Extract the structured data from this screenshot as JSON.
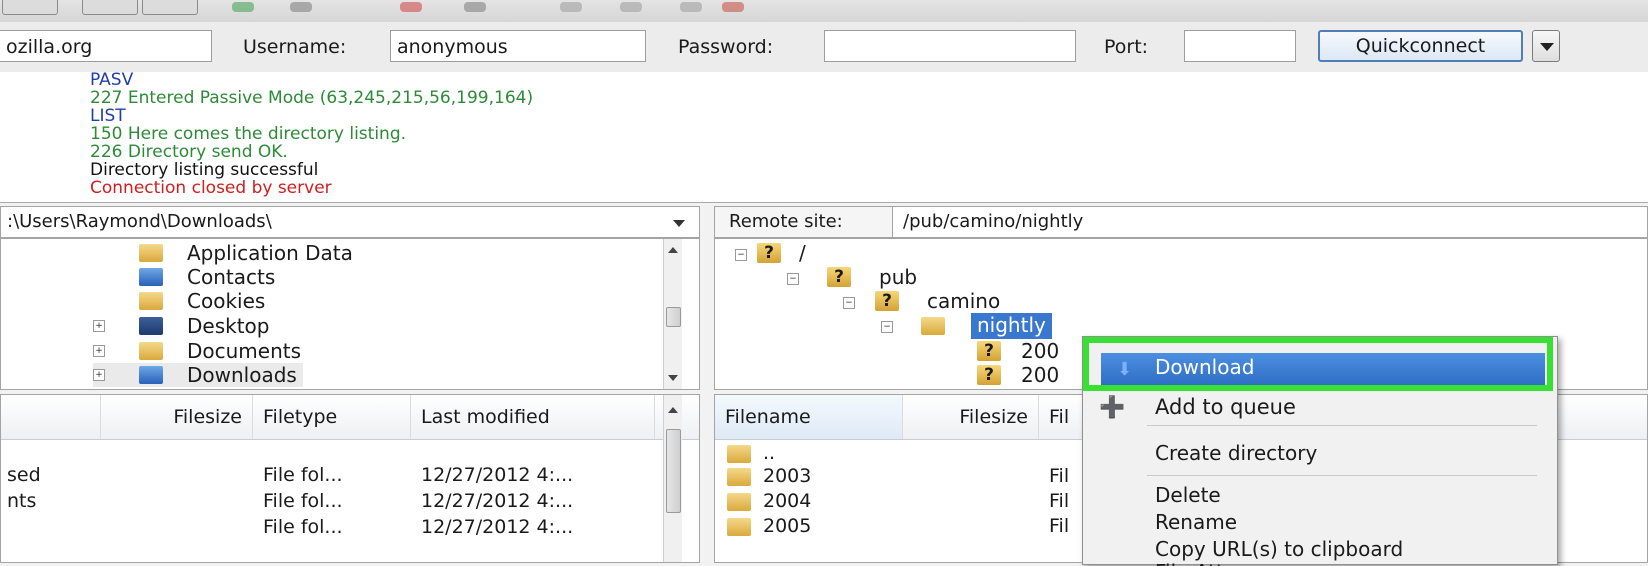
{
  "quickconnect": {
    "host_value": "ozilla.org",
    "username_label": "Username:",
    "username_value": "anonymous",
    "password_label": "Password:",
    "password_value": "",
    "port_label": "Port:",
    "port_value": "",
    "button_label": "Quickconnect"
  },
  "log": [
    {
      "text": "PASV",
      "color": "blue"
    },
    {
      "text": "227 Entered Passive Mode (63,245,215,56,199,164)",
      "color": "green"
    },
    {
      "text": "LIST",
      "color": "blue"
    },
    {
      "text": "150 Here comes the directory listing.",
      "color": "green"
    },
    {
      "text": "226 Directory send OK.",
      "color": "green"
    },
    {
      "text": "Directory listing successful",
      "color": "black"
    },
    {
      "text": "Connection closed by server",
      "color": "red"
    }
  ],
  "local": {
    "path": ":\\Users\\Raymond\\Downloads\\",
    "tree": [
      {
        "label": "Application Data"
      },
      {
        "label": "Contacts"
      },
      {
        "label": "Cookies"
      },
      {
        "label": "Desktop"
      },
      {
        "label": "Documents"
      },
      {
        "label": "Downloads"
      }
    ],
    "columns": [
      "Filesize",
      "Filetype",
      "Last modified"
    ],
    "rows": [
      {
        "name": "sed",
        "type": "File fol...",
        "modified": "12/27/2012 4:..."
      },
      {
        "name": "nts",
        "type": "File fol...",
        "modified": "12/27/2012 4:..."
      },
      {
        "name": "",
        "type": "File fol...",
        "modified": "12/27/2012 4:..."
      }
    ]
  },
  "remote": {
    "label": "Remote site:",
    "path": "/pub/camino/nightly",
    "tree": [
      {
        "label": "/"
      },
      {
        "label": "pub"
      },
      {
        "label": "camino"
      },
      {
        "label": "nightly"
      },
      {
        "label": "200"
      },
      {
        "label": "200"
      }
    ],
    "columns": [
      "Filename",
      "Filesize",
      "Fil"
    ],
    "rows": [
      {
        "name": "..",
        "type": ""
      },
      {
        "name": "2003",
        "type": "Fil"
      },
      {
        "name": "2004",
        "type": "Fil"
      },
      {
        "name": "2005",
        "type": "Fil"
      }
    ]
  },
  "context_menu": {
    "items": [
      "Download",
      "Add to queue",
      "Create directory",
      "Delete",
      "Rename",
      "Copy URL(s) to clipboard",
      "File Att"
    ],
    "highlight_color": "#39e034"
  },
  "colors": {
    "selection": "#3a78d0",
    "log_blue": "#1f3fa8",
    "log_green": "#2d8a37",
    "log_red": "#d11d1d"
  }
}
